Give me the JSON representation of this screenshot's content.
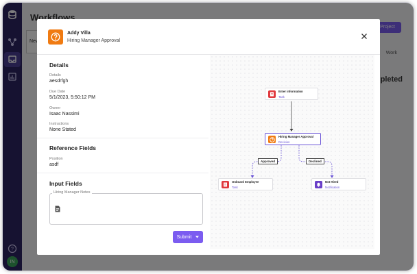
{
  "background": {
    "page_title": "Workflows",
    "new_button_label": "New",
    "project_button_label": "Project",
    "work_filter_label": "Work",
    "completed_heading": "pleted",
    "user_initials": "IN"
  },
  "modal": {
    "assignee_name": "Addy Villa",
    "step_name": "Hiring Manager Approval",
    "details_section": {
      "title": "Details",
      "details_label": "Details",
      "details_value": "aesdrfgh",
      "due_date_label": "Due Date",
      "due_date_value": "5/1/2023, 5:50:12 PM",
      "owner_label": "Owner",
      "owner_value": "Isaac Nassimi",
      "instructions_label": "Instructions",
      "instructions_value": "None Stated"
    },
    "reference_section": {
      "title": "Reference Fields",
      "position_label": "Position",
      "position_value": "asdf"
    },
    "input_section": {
      "title": "Input Fields",
      "notes_label": "Hiring Manager Notes",
      "notes_value": ""
    },
    "submit_label": "Submit"
  },
  "workflow": {
    "nodes": {
      "enter_information": {
        "title": "Enter information",
        "type": "Task",
        "color": "#e0393e"
      },
      "hiring_manager_approval": {
        "title": "Hiring Manager Approval",
        "type": "Decision",
        "color": "#f07b12"
      },
      "onboard_employee": {
        "title": "Onboard Employee",
        "type": "Task",
        "color": "#e0393e"
      },
      "not_hired": {
        "title": "Not Hired",
        "type": "Notification",
        "color": "#6a3fc8"
      }
    },
    "edges": {
      "approved_label": "Approved",
      "declined_label": "Declined"
    }
  },
  "colors": {
    "accent": "#7b5cf0",
    "sidebar": "#2d2563"
  }
}
